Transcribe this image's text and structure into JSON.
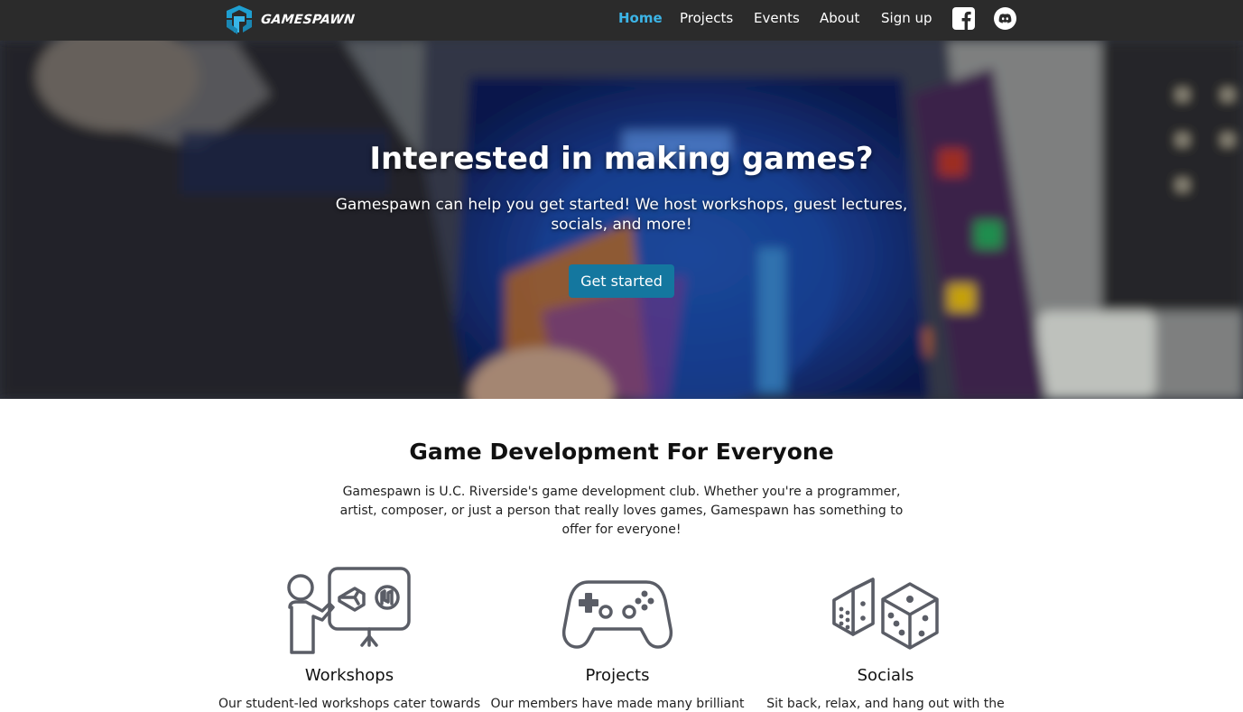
{
  "brand": {
    "name": "GAMESPAWN",
    "logo_icon": "gamespawn-logo-icon"
  },
  "nav": {
    "items": [
      {
        "label": "Home",
        "active": true
      },
      {
        "label": "Projects",
        "active": false
      },
      {
        "label": "Events",
        "active": false
      },
      {
        "label": "About",
        "active": false
      },
      {
        "label": "Sign up",
        "active": false
      }
    ],
    "social": [
      {
        "icon": "facebook-icon"
      },
      {
        "icon": "discord-icon"
      }
    ]
  },
  "hero": {
    "title": "Interested in making games?",
    "subtitle": "Gamespawn can help you get started! We host workshops, guest lectures, socials, and more!",
    "button": "Get started"
  },
  "intro": {
    "title": "Game Development For Everyone",
    "text": "Gamespawn is U.C. Riverside's game development club. Whether you're a programmer, artist, composer, or just a person that really loves games, Gamespawn has something to offer for everyone!"
  },
  "features": [
    {
      "icon": "teacher-presentation-icon",
      "title": "Workshops",
      "text": "Our student-led workshops cater towards"
    },
    {
      "icon": "gamepad-icon",
      "title": "Projects",
      "text": "Our members have made many brilliant"
    },
    {
      "icon": "dice-icon",
      "title": "Socials",
      "text": "Sit back, relax, and hang out with the"
    }
  ],
  "colors": {
    "navbar_bg": "#2b2b2b",
    "nav_active": "#3cb4e6",
    "button_bg": "#14779f",
    "icon_gray": "#5a5d66"
  }
}
